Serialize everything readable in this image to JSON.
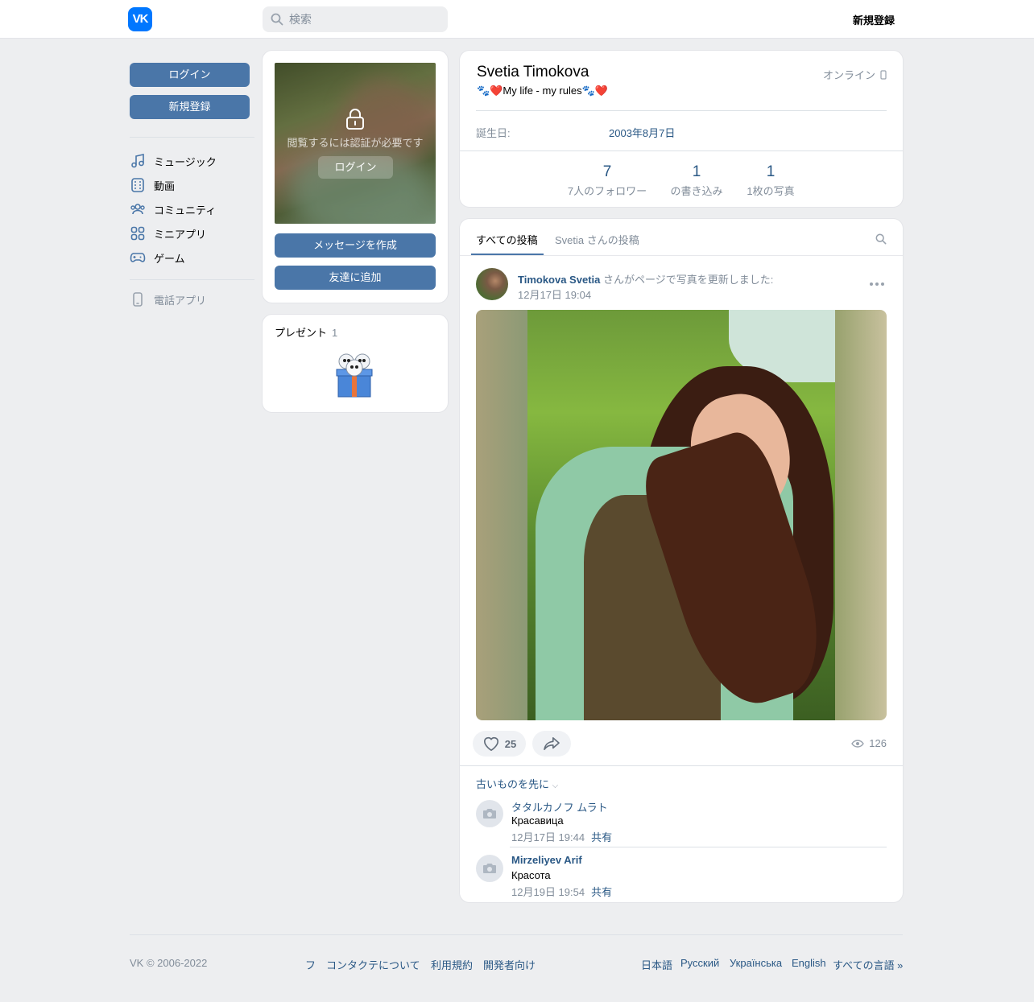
{
  "header": {
    "logo_text": "VK",
    "search_placeholder": "検索",
    "register_label": "新規登録"
  },
  "left_sidebar": {
    "login_label": "ログイン",
    "register_label": "新規登録",
    "nav": [
      {
        "label": "ミュージック",
        "icon": "music-icon"
      },
      {
        "label": "動画",
        "icon": "video-icon"
      },
      {
        "label": "コミュニティ",
        "icon": "community-icon"
      },
      {
        "label": "ミニアプリ",
        "icon": "mini-apps-icon"
      },
      {
        "label": "ゲーム",
        "icon": "games-icon"
      }
    ],
    "phone_app_label": "電話アプリ"
  },
  "avatar_card": {
    "auth_text": "閲覧するには認証が必要です",
    "auth_login_label": "ログイン",
    "message_button": "メッセージを作成",
    "add_friend_button": "友達に追加"
  },
  "gifts": {
    "title": "プレゼント",
    "count": "1"
  },
  "profile": {
    "name": "Svetia Timokova",
    "status": "🐾❤️My life - my rules🐾❤️",
    "online": "オンライン",
    "birthday_label": "誕生日:",
    "birthday_value": "2003年8月7日",
    "counters": [
      {
        "num": "7",
        "label": "7人のフォロワー"
      },
      {
        "num": "1",
        "label": "の書き込み"
      },
      {
        "num": "1",
        "label": "1枚の写真"
      }
    ]
  },
  "wall": {
    "tabs": [
      "すべての投稿",
      "Svetia さんの投稿"
    ],
    "post": {
      "author": "Timokova Svetia",
      "action": " さんがページで写真を更新しました:",
      "date": "12月17日 19:04",
      "likes": "25",
      "views": "126"
    },
    "sort_label": "古いものを先に",
    "comments": [
      {
        "name": "タタルカノフ ムラト",
        "text": "Красавица",
        "date": "12月17日 19:44",
        "share": "共有"
      },
      {
        "name": "Mirzeliyev Arif",
        "text": "Красота",
        "date": "12月19日 19:54",
        "share": "共有"
      }
    ]
  },
  "footer": {
    "copyright": "VK © 2006-2022",
    "links": [
      "フ",
      "コンタクテについて",
      "利用規約",
      "開発者向け"
    ],
    "languages": [
      "日本語",
      "Русский",
      "Українська",
      "English",
      "すべての言語 »"
    ]
  },
  "colors": {
    "accent": "#4a76a8",
    "link": "#2a5885",
    "brand": "#0077ff",
    "muted": "#818c99"
  }
}
